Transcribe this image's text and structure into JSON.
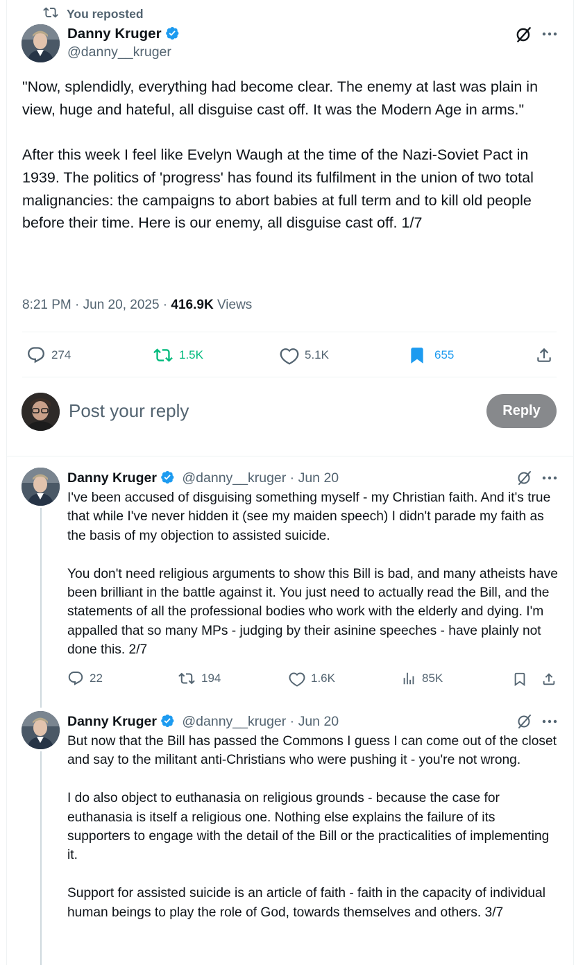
{
  "repost_label": "You reposted",
  "main_post": {
    "author_name": "Danny Kruger",
    "handle": "@danny__kruger",
    "text": "\"Now, splendidly, everything had become clear. The enemy at last was plain in view, huge and hateful, all disguise cast off. It was the Modern Age in arms.\"\n\nAfter this week I feel like Evelyn Waugh at the time of the Nazi-Soviet Pact in 1939. The politics of 'progress' has found its fulfilment in the union of two total malignancies: the campaigns to abort babies at full term and to kill old people before their time. Here is our enemy, all disguise cast off. 1/7",
    "time": "8:21 PM · Jun 20, 2025 · ",
    "views_count": "416.9K",
    "views_label": " Views",
    "replies": "274",
    "reposts": "1.5K",
    "likes": "5.1K",
    "bookmarks": "655"
  },
  "composer": {
    "placeholder": "Post your reply",
    "reply_button": "Reply"
  },
  "replies": [
    {
      "author_name": "Danny Kruger",
      "handle_date": "@danny__kruger · Jun 20",
      "text": "I've been accused of disguising something myself - my Christian faith. And it's true that while I've never hidden it (see my maiden speech) I didn't parade my faith as the basis of my objection to assisted suicide.\n\nYou don't need religious arguments to show this Bill is bad, and many atheists have been brilliant in the battle against it. You just need to actually read the Bill, and the statements of all the professional bodies who work with the elderly and dying. I'm appalled that so many MPs - judging by their asinine speeches - have plainly not done this. 2/7",
      "replies": "22",
      "reposts": "194",
      "likes": "1.6K",
      "views": "85K"
    },
    {
      "author_name": "Danny Kruger",
      "handle_date": "@danny__kruger · Jun 20",
      "text": "But now that the Bill has passed the Commons I guess I can come out of the closet and say to the militant anti-Christians who were pushing it - you're not wrong.\n\nI do also object to euthanasia on religious grounds - because the case for euthanasia is itself a religious one. Nothing else explains the failure of its supporters to engage with the detail of the Bill or the practicalities of implementing it.\n\nSupport for assisted suicide is an article of faith - faith in the capacity of individual human beings to play the role of God, towards themselves and others. 3/7"
    }
  ],
  "colors": {
    "accent": "#1d9bf0",
    "repost_active": "#00ba7c",
    "text": "#0f1419",
    "muted": "#536471",
    "reply_button_bg": "#87898c"
  },
  "icons": [
    "repost-icon",
    "verified-badge-icon",
    "grok-icon",
    "more-icon",
    "reply-icon",
    "like-icon",
    "bookmark-icon",
    "share-icon",
    "views-icon"
  ]
}
